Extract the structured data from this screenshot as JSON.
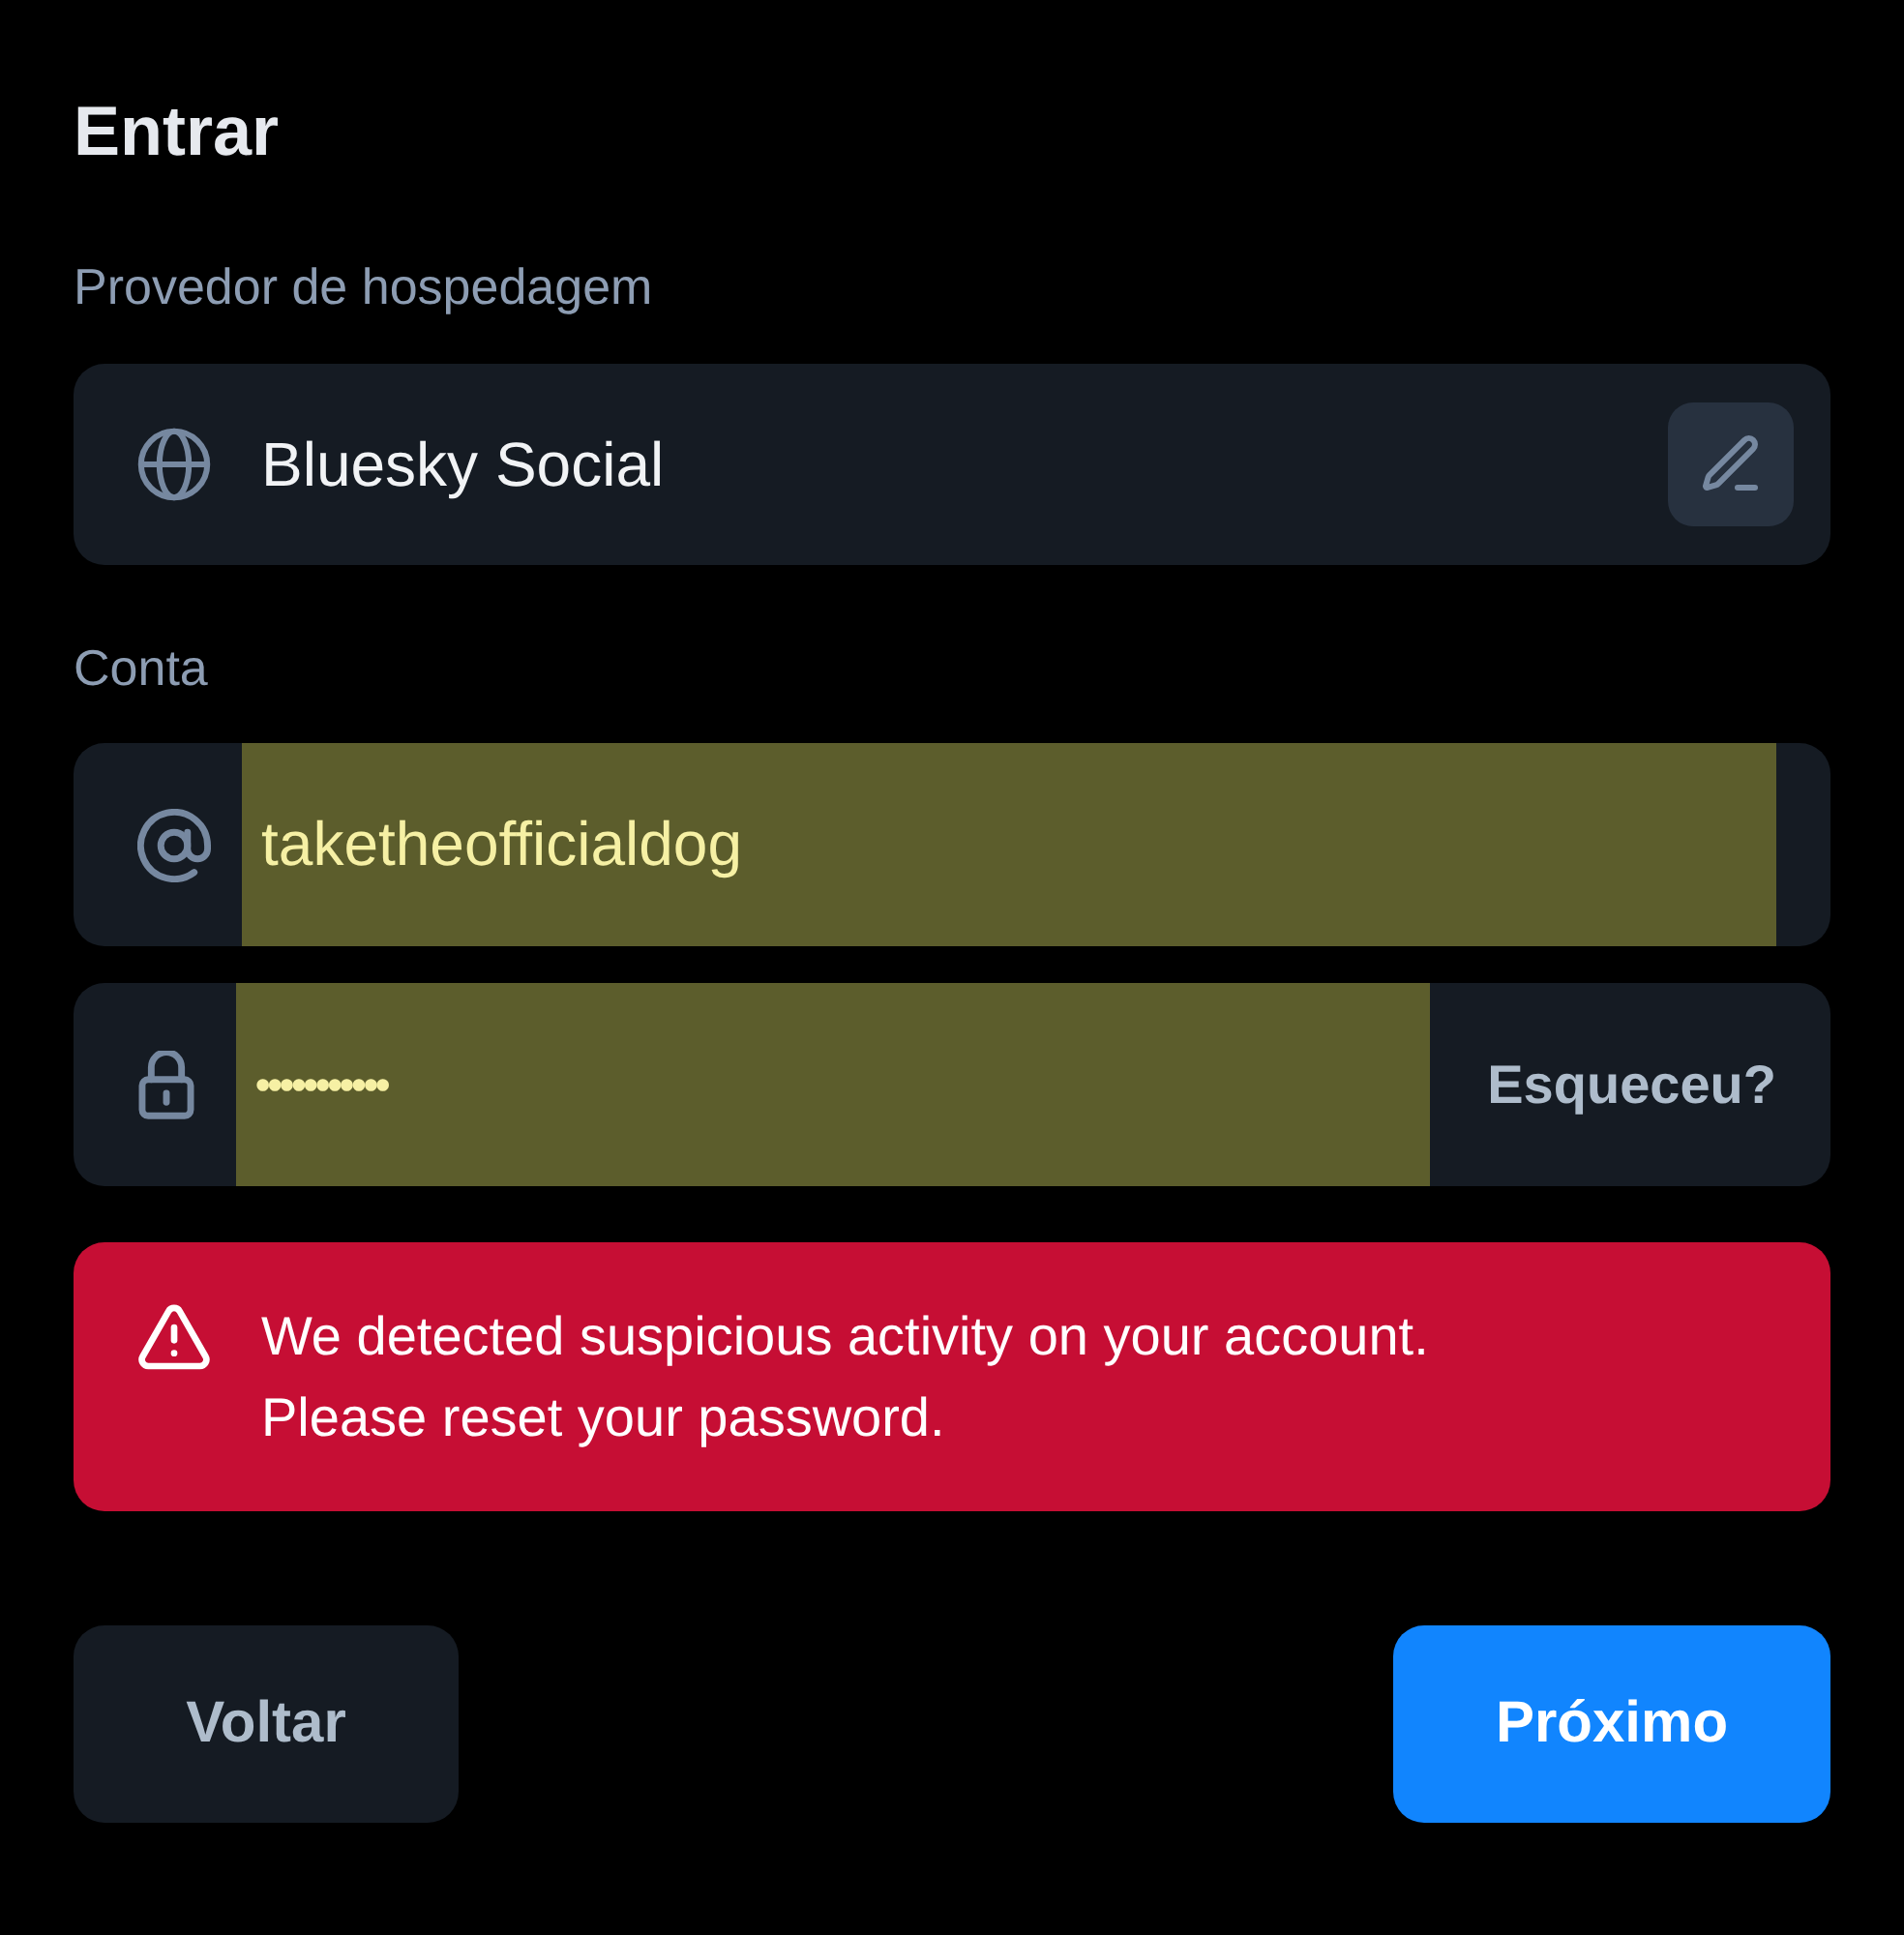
{
  "title": "Entrar",
  "hosting": {
    "label": "Provedor de hospedagem",
    "value": "Bluesky Social"
  },
  "account": {
    "label": "Conta",
    "username": {
      "value": "taketheofficialdog",
      "autofilled": true
    },
    "password": {
      "value": "•••••••••••",
      "autofilled": true
    },
    "forgot_link": "Esqueceu?"
  },
  "error": {
    "message": "We detected suspicious activity on your account. Please reset your password."
  },
  "buttons": [
    {
      "label": "Voltar",
      "kind": "secondary"
    },
    {
      "label": "Próximo",
      "kind": "primary"
    }
  ]
}
